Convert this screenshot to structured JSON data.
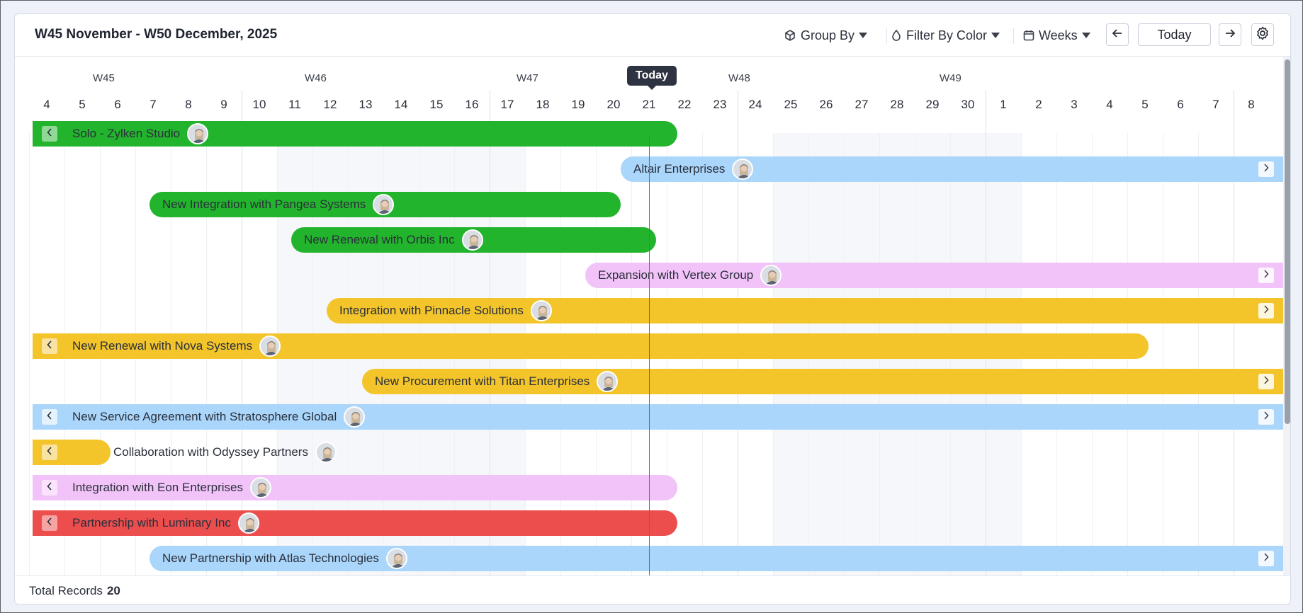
{
  "header": {
    "title": "W45 November - W50 December, 2025",
    "group_by": "Group By",
    "filter_by_color": "Filter By Color",
    "view_mode": "Weeks",
    "today_button": "Today",
    "icons": [
      "group-by-icon",
      "color-drop-icon",
      "calendar-icon",
      "arrow-left-icon",
      "arrow-right-icon",
      "settings-gear-icon"
    ]
  },
  "timeline": {
    "weeks": [
      "W45",
      "W46",
      "W47",
      "W48",
      "W49"
    ],
    "days": [
      "4",
      "5",
      "6",
      "7",
      "8",
      "9",
      "10",
      "11",
      "12",
      "13",
      "14",
      "15",
      "16",
      "17",
      "18",
      "19",
      "20",
      "21",
      "22",
      "23",
      "24",
      "25",
      "26",
      "27",
      "28",
      "29",
      "30",
      "1",
      "2",
      "3",
      "4",
      "5",
      "6",
      "7",
      "8"
    ],
    "today_label": "Today",
    "today_day": "21"
  },
  "colors": {
    "green": "#23b42d",
    "blue": "#aad6fb",
    "pink": "#f2c3f9",
    "yellow": "#f3c52b",
    "red": "#ec4e4e",
    "today_line": "#e23c3c"
  },
  "records": [
    {
      "name": "Solo - Zylken Studio",
      "color": "green",
      "arrow": "left"
    },
    {
      "name": "Altair Enterprises",
      "color": "blue",
      "arrow": "right"
    },
    {
      "name": "New Integration with Pangea Systems",
      "color": "green",
      "arrow": "none"
    },
    {
      "name": "New Renewal with Orbis Inc",
      "color": "green",
      "arrow": "none"
    },
    {
      "name": "Expansion with Vertex Group",
      "color": "pink",
      "arrow": "right"
    },
    {
      "name": "Integration with Pinnacle Solutions",
      "color": "yellow",
      "arrow": "right"
    },
    {
      "name": "New Renewal with Nova Systems",
      "color": "yellow",
      "arrow": "left"
    },
    {
      "name": "New Procurement with Titan Enterprises",
      "color": "yellow",
      "arrow": "right"
    },
    {
      "name": "New Service Agreement with Stratosphere Global",
      "color": "blue",
      "arrow": "both"
    },
    {
      "name": "Collaboration with Odyssey Partners",
      "color": "yellow",
      "arrow": "left"
    },
    {
      "name": "Integration with Eon Enterprises",
      "color": "pink",
      "arrow": "left"
    },
    {
      "name": "Partnership with Luminary Inc",
      "color": "red",
      "arrow": "left"
    },
    {
      "name": "New Partnership with Atlas Technologies",
      "color": "blue",
      "arrow": "right"
    }
  ],
  "footer": {
    "total_label": "Total Records",
    "total_value": "20"
  }
}
